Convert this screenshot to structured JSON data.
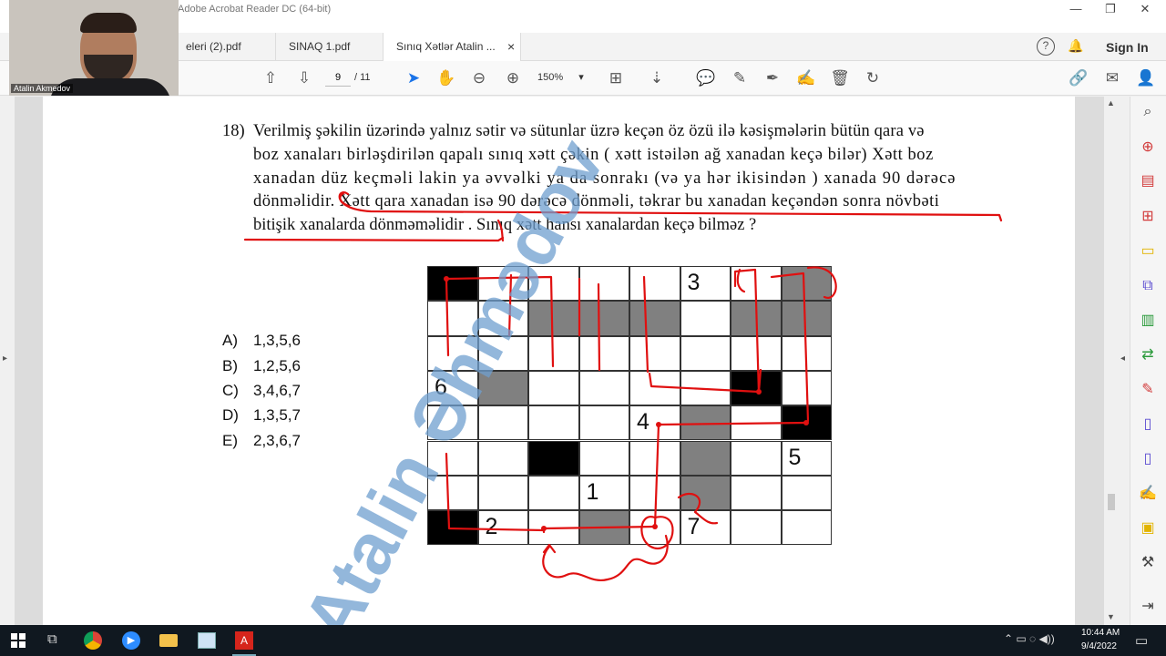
{
  "window": {
    "title": "Adobe Acrobat Reader DC (64-bit)",
    "controls": [
      "—",
      "❐",
      "✕"
    ]
  },
  "webcam": {
    "name": "Atalin Akmedov"
  },
  "tabs": [
    {
      "label": "eleri (2).pdf",
      "active": false
    },
    {
      "label": "SINAQ 1.pdf",
      "active": false
    },
    {
      "label": "Sınıq Xətlər Atalin ...",
      "active": true,
      "close": "×"
    }
  ],
  "header_actions": {
    "help": "?",
    "sign_in": "Sign In"
  },
  "toolbar": {
    "page_current": "9",
    "page_sep": "/",
    "page_total": "11",
    "zoom": "150%"
  },
  "question": {
    "number": "18)",
    "lines": [
      "Verilmiş şəkilin üzərində yalnız sətir və sütunlar üzrə keçən öz özü ilə kəsişmələrin bütün qara və",
      "boz xanaları birləşdirilən qapalı sınıq xətt çəkin ( xətt istəilən ağ xanadan keçə bilər)  Xətt boz",
      "xanadan düz keçməli lakin ya əvvəlki ya da sonrakı (və ya hər ikisindən  ) xanada 90 dərəcə",
      "dönməlidir. Xətt qara xanadan isə 90 dərəcə dönməli,  təkrar bu xanadan keçəndən sonra növbəti",
      "bitişik xanalarda dönməməlidir . Sınıq xətt hansı xanalardan keçə bilməz ?"
    ]
  },
  "options": [
    {
      "letter": "A)",
      "value": "1,3,5,6"
    },
    {
      "letter": "B)",
      "value": "1,2,5,6"
    },
    {
      "letter": "C)",
      "value": "3,4,6,7"
    },
    {
      "letter": "D)",
      "value": "1,3,5,7"
    },
    {
      "letter": "E)",
      "value": "2,3,6,7"
    }
  ],
  "grid": {
    "rows": 8,
    "cols": 8,
    "cells": [
      "B......G",
      "..GGG.GG",
      "........",
      ".G....B.",
      ".....G.B",
      "..B..G..",
      ".....G..",
      "B..G...."
    ],
    "numbers": [
      {
        "row": 0,
        "col": 5,
        "label": "3"
      },
      {
        "row": 3,
        "col": 0,
        "label": "6"
      },
      {
        "row": 4,
        "col": 4,
        "label": "4"
      },
      {
        "row": 5,
        "col": 7,
        "label": "5"
      },
      {
        "row": 6,
        "col": 3,
        "label": "1"
      },
      {
        "row": 7,
        "col": 1,
        "label": "2"
      },
      {
        "row": 7,
        "col": 5,
        "label": "7"
      }
    ]
  },
  "watermark": "Atalin Əhmədov",
  "taskbar": {
    "time": "10:44 AM",
    "date": "9/4/2022"
  },
  "colors": {
    "black_cell": "#000000",
    "gray_cell": "#808080",
    "ink": "#e01010",
    "watermark": "#6f9fcf"
  }
}
